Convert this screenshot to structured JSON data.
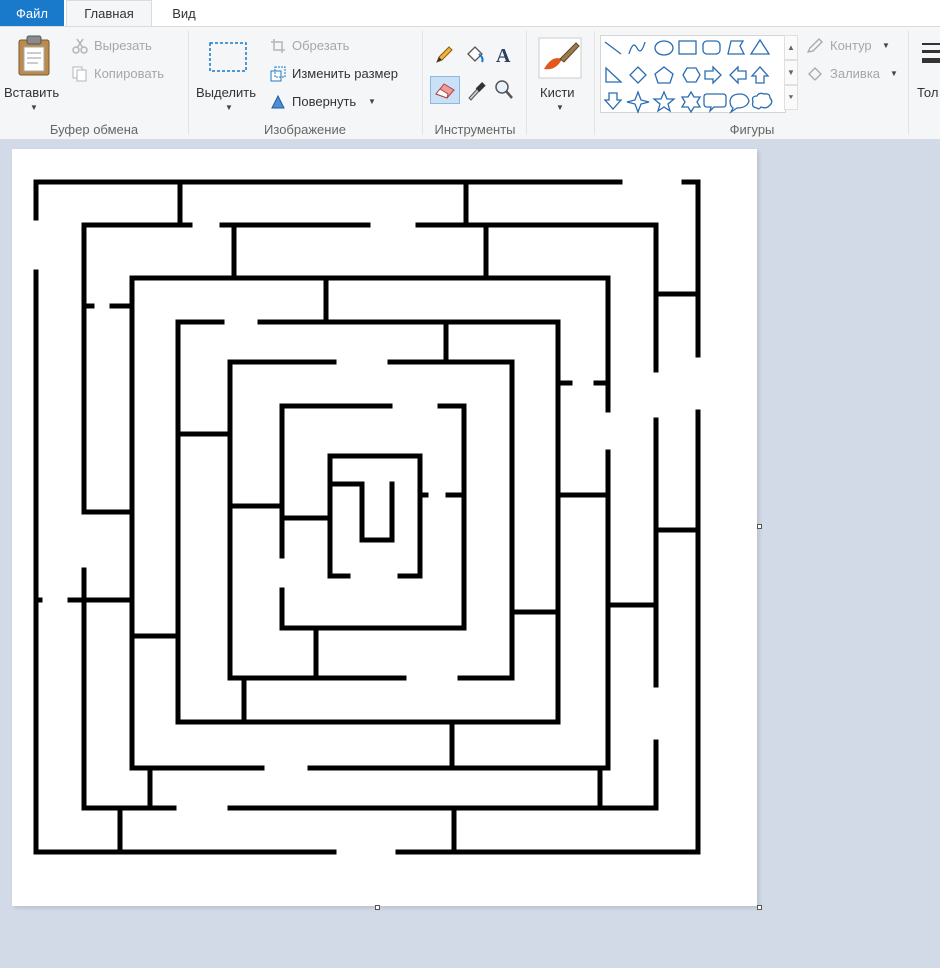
{
  "tabs": {
    "file": "Файл",
    "home": "Главная",
    "view": "Вид"
  },
  "clipboard": {
    "paste": "Вставить",
    "cut": "Вырезать",
    "copy": "Копировать",
    "label": "Буфер обмена"
  },
  "image": {
    "select": "Выделить",
    "crop": "Обрезать",
    "resize": "Изменить размер",
    "rotate": "Повернуть",
    "label": "Изображение"
  },
  "tools": {
    "label": "Инструменты",
    "brushes": "Кисти"
  },
  "shapes": {
    "label": "Фигуры",
    "outline": "Контур",
    "fill": "Заливка"
  },
  "thickness": {
    "label": "Тол"
  },
  "colors": {
    "accent": "#1979ca",
    "maze": "#000000",
    "canvas": "#ffffff",
    "workspace": "#d2dae7"
  }
}
